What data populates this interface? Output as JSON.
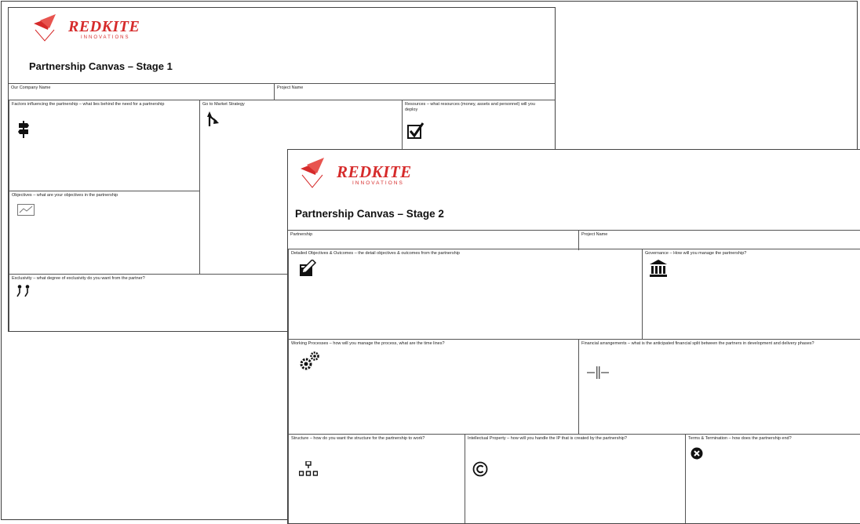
{
  "colors": {
    "brand": "#d62b2b",
    "border": "#555555"
  },
  "stage1": {
    "brand_name": "REDKITE",
    "brand_sub": "INNOVATIONS",
    "title": "Partnership Canvas – Stage 1",
    "company_label": "Our Company Name",
    "project_label": "Project Name",
    "factors_label": "Factors influencing the partnership – what lies behind the need for a partnership",
    "gtm_label": "Go to Market Strategy",
    "resources_label": "Resources – what resources (money, assets and personnel) will you deploy",
    "objectives_label": "Objectives – what are your objectives in the partnership",
    "exclusivity_label": "Exclusivity – what degree of exclusivity do you want from the partner?",
    "icons": [
      "signpost-icon",
      "direction-arrow-icon",
      "checkbox-icon",
      "chart-icon",
      "people-icon"
    ]
  },
  "stage2": {
    "brand_name": "REDKITE",
    "brand_sub": "INNOVATIONS",
    "title": "Partnership Canvas – Stage 2",
    "partnership_label": "Partnership",
    "project_label": "Project Name",
    "detailed_label": "Detailed Objectives & Outcomes – the detail objectives & outcomes from the partnership",
    "governance_label": "Governance – How will you manage the partnership?",
    "working_label": "Working Processes – how will you manage the process, what are the time lines?",
    "financial_label": "Financial arrangements – what is the anticipated financial split between the partners in development and delivery phases?",
    "structure_label": "Structure – how do you want the structure for the partnership to work?",
    "ip_label": "Intellectual Property – how will you handle the IP that is created by the partnership?",
    "terms_label": "Terms & Termination – how does the partnership end?",
    "icons": [
      "pencil-note-icon",
      "bank-icon",
      "gears-icon",
      "split-arrows-icon",
      "org-chart-icon",
      "copyright-icon",
      "close-circle-icon"
    ]
  }
}
